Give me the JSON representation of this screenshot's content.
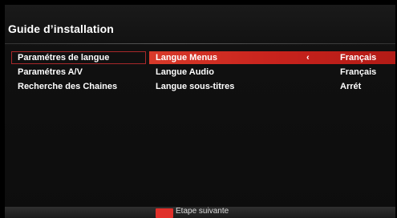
{
  "window": {
    "title": "Guide d’installation"
  },
  "left_menu": [
    {
      "label": "Paramétres de langue",
      "active": true
    },
    {
      "label": "Paramétres A/V",
      "active": false
    },
    {
      "label": "Recherche des Chaines",
      "active": false
    }
  ],
  "settings": [
    {
      "label": "Langue Menus",
      "value": "Français",
      "arrow": "‹",
      "active": true
    },
    {
      "label": "Langue Audio",
      "value": "Français",
      "arrow": "",
      "active": false
    },
    {
      "label": "Langue sous-titres",
      "value": "Arrét",
      "arrow": "",
      "active": false
    }
  ],
  "footer": {
    "next_label": "Etape suivante"
  },
  "colors": {
    "accent": "#d0281f",
    "background": "#0d0d0d"
  }
}
